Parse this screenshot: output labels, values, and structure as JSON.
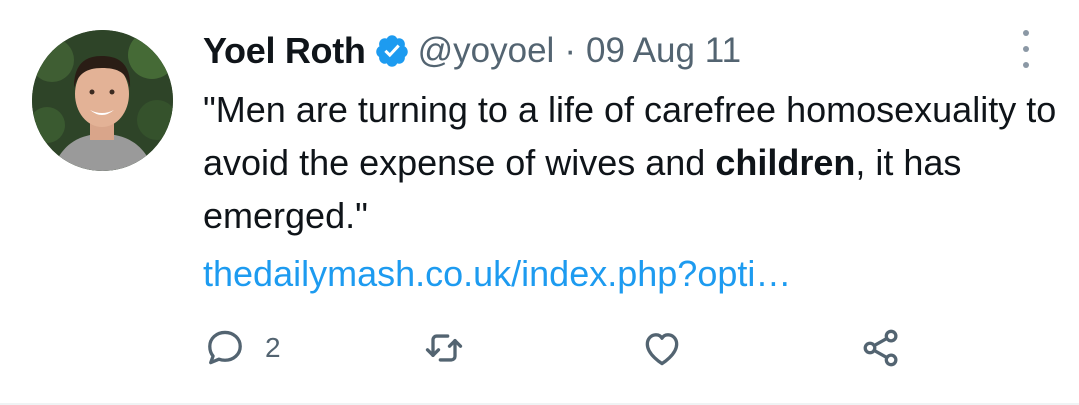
{
  "tweet": {
    "author_name": "Yoel Roth",
    "handle": "@yoyoel",
    "separator": "·",
    "date": "09 Aug 11",
    "text_part1": "\"Men are turning to a life of carefree homosexuality to avoid the expense of wives and ",
    "text_bold": "children",
    "text_part2": ", it has emerged.\"",
    "link_text": "thedailymash.co.uk/index.php?opti…",
    "reply_count": "2"
  },
  "icons": {
    "verified": "verified-badge-icon",
    "more": "more-options-icon",
    "reply": "reply-icon",
    "retweet": "retweet-icon",
    "like": "heart-icon",
    "share": "share-icon"
  },
  "colors": {
    "text": "#0f1419",
    "secondary": "#536471",
    "link": "#1d9bf0",
    "verified": "#1d9bf0"
  }
}
